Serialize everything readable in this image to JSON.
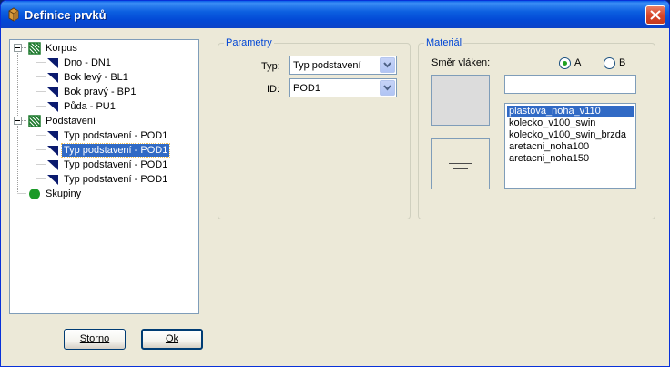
{
  "window": {
    "title": "Definice prvků"
  },
  "tree": {
    "nodes": [
      {
        "label": "Korpus",
        "kind": "group",
        "icon": "striped-green-icon"
      },
      {
        "label": "Dno - DN1",
        "kind": "leaf",
        "icon": "triangle-blue-icon"
      },
      {
        "label": "Bok levý - BL1",
        "kind": "leaf",
        "icon": "triangle-blue-icon"
      },
      {
        "label": "Bok pravý - BP1",
        "kind": "leaf",
        "icon": "triangle-blue-icon"
      },
      {
        "label": "Půda - PU1",
        "kind": "leaf",
        "icon": "triangle-blue-icon"
      },
      {
        "label": "Podstavení",
        "kind": "group",
        "icon": "striped-green-icon"
      },
      {
        "label": "Typ podstavení - POD1",
        "kind": "leaf",
        "icon": "triangle-blue-icon"
      },
      {
        "label": "Typ podstavení - POD1",
        "kind": "leaf",
        "icon": "triangle-blue-icon",
        "selected": true
      },
      {
        "label": "Typ podstavení - POD1",
        "kind": "leaf",
        "icon": "triangle-blue-icon"
      },
      {
        "label": "Typ podstavení - POD1",
        "kind": "leaf",
        "icon": "triangle-blue-icon"
      },
      {
        "label": "Skupiny",
        "kind": "root",
        "icon": "green-circle-icon"
      }
    ]
  },
  "parametry": {
    "title": "Parametry",
    "typ_label": "Typ:",
    "typ_value": "Typ podstavení",
    "id_label": "ID:",
    "id_value": "POD1"
  },
  "material": {
    "title": "Materiál",
    "grain_label": "Směr vláken:",
    "radio_a": "A",
    "radio_b": "B",
    "selected_radio": "A",
    "search_value": "",
    "items": [
      "plastova_noha_v110",
      "kolecko_v100_swin",
      "kolecko_v100_swin_brzda",
      "aretacni_noha100",
      "aretacni_noha150"
    ],
    "selected_index": 0
  },
  "buttons": {
    "storno": "Storno",
    "ok": "Ok"
  },
  "colors": {
    "selection": "#316ac5",
    "group_title": "#0046d5",
    "tree_leaf_icon": "#0a1a6e",
    "tree_group_icon": "#1e7a2e"
  }
}
